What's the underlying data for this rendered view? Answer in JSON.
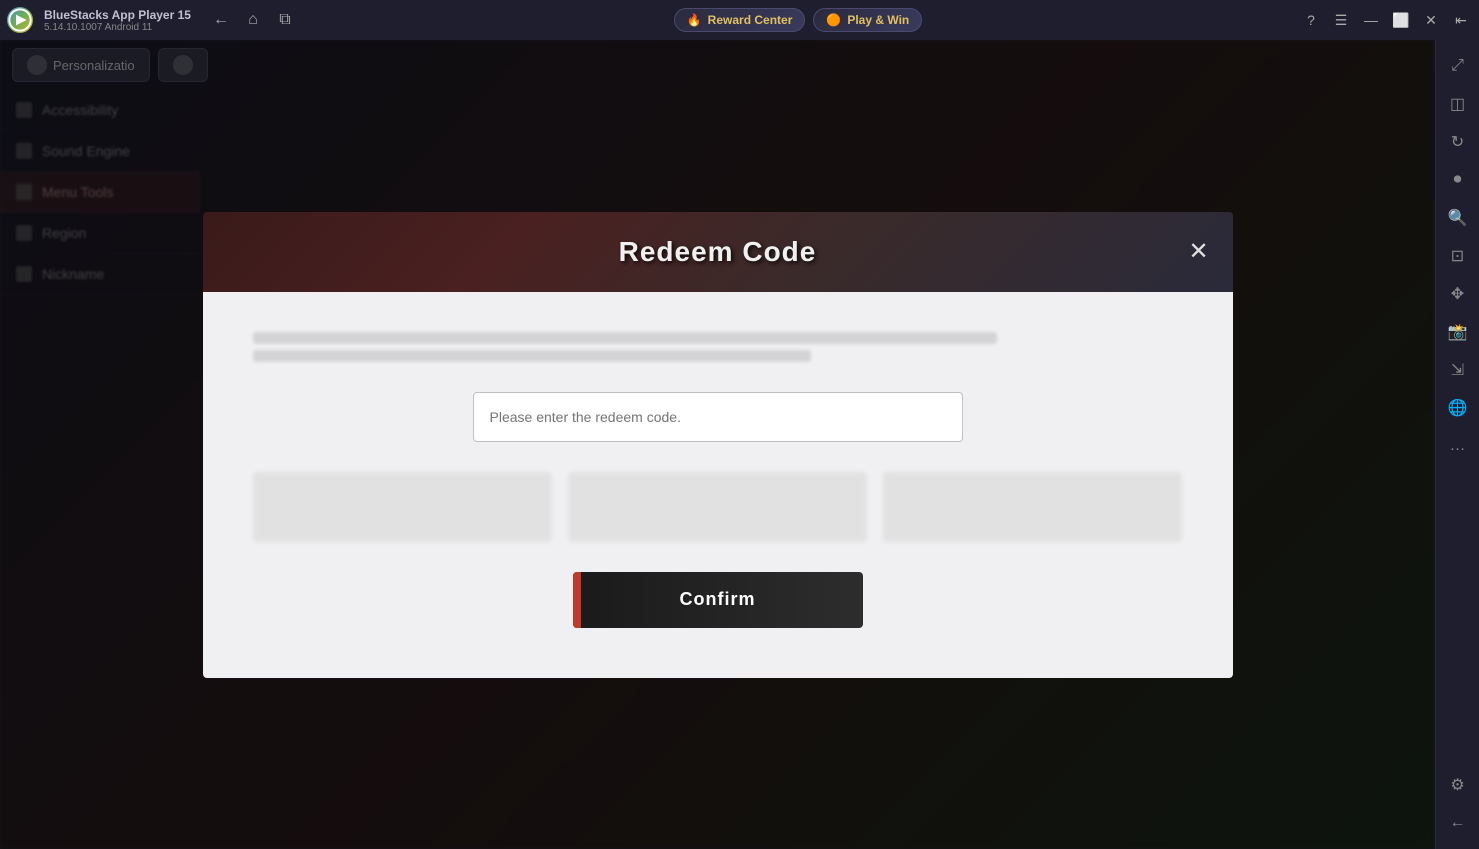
{
  "titleBar": {
    "appName": "BlueStacks App Player 15",
    "appVersion": "5.14.10.1007  Android 11",
    "rewardCenter": "Reward Center",
    "playWin": "Play & Win",
    "nav": {
      "back": "←",
      "home": "⌂",
      "tabs": "⧉"
    },
    "windowControls": {
      "help": "?",
      "menu": "☰",
      "minimize": "—",
      "maximize": "⬜",
      "close": "✕",
      "undock": "⇤"
    }
  },
  "rightSidebar": {
    "icons": [
      {
        "name": "expand-icon",
        "symbol": "⤢"
      },
      {
        "name": "screenshot-icon",
        "symbol": "📷"
      },
      {
        "name": "rotate-icon",
        "symbol": "↻"
      },
      {
        "name": "record-icon",
        "symbol": "⏺"
      },
      {
        "name": "zoom-in-icon",
        "symbol": "🔍"
      },
      {
        "name": "crop-icon",
        "symbol": "⊡"
      },
      {
        "name": "pan-icon",
        "symbol": "✥"
      },
      {
        "name": "camera2-icon",
        "symbol": "📸"
      },
      {
        "name": "resize-icon",
        "symbol": "⇲"
      },
      {
        "name": "globe-icon",
        "symbol": "🌐"
      },
      {
        "name": "more-icon",
        "symbol": "…"
      },
      {
        "name": "settings-icon",
        "symbol": "⚙"
      },
      {
        "name": "back-icon",
        "symbol": "←"
      }
    ]
  },
  "modal": {
    "title": "Redeem Code",
    "closeButton": "✕",
    "inputPlaceholder": "Please enter the redeem code.",
    "confirmButton": "Confirm"
  },
  "toolbar": {
    "btn1": "Personalizatio",
    "btn2": ""
  },
  "leftMenu": {
    "items": [
      {
        "label": "Accessibility",
        "active": false
      },
      {
        "label": "Sound Engine",
        "active": false
      },
      {
        "label": "Menu Tools",
        "active": true
      },
      {
        "label": "Region",
        "active": false
      },
      {
        "label": "Nickname",
        "active": false
      }
    ]
  }
}
